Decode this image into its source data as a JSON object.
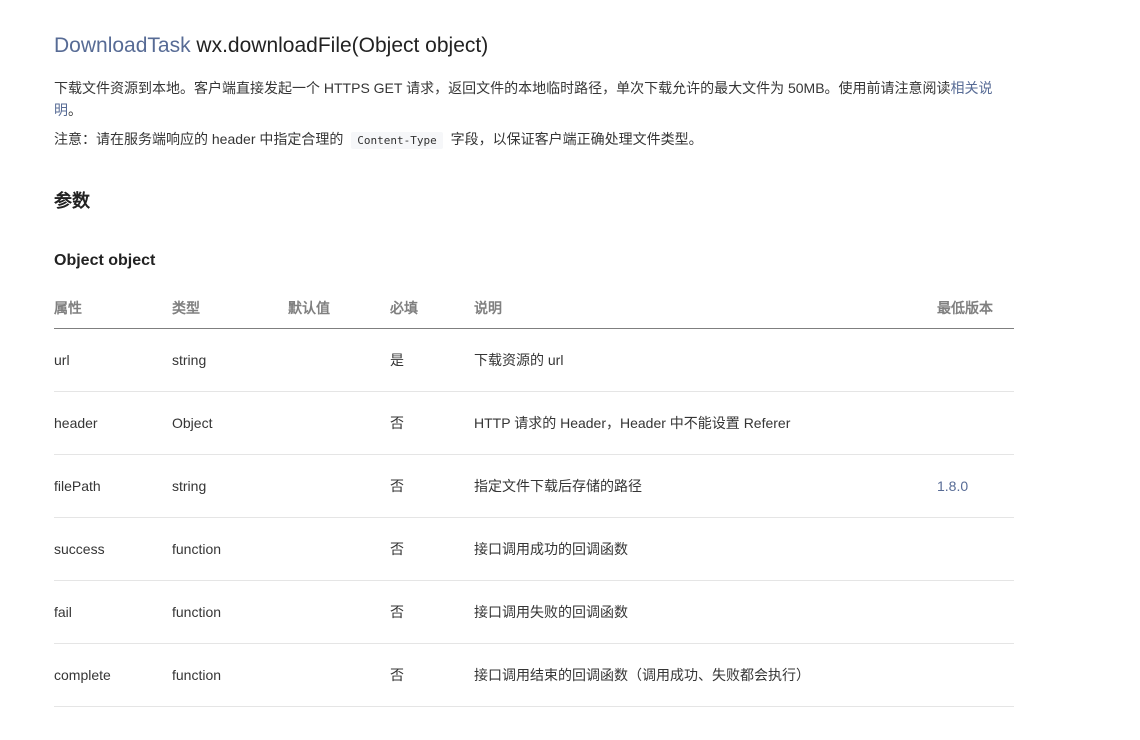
{
  "title": {
    "link_text": "DownloadTask",
    "signature": "wx.downloadFile(Object object)"
  },
  "description": {
    "text": "下载文件资源到本地。客户端直接发起一个 HTTPS GET 请求，返回文件的本地临时路径，单次下载允许的最大文件为 50MB。使用前请注意阅读",
    "link_text": "相关说明",
    "end": "。"
  },
  "note": {
    "before": "注意：请在服务端响应的 header 中指定合理的",
    "code": "Content-Type",
    "after": "字段，以保证客户端正确处理文件类型。"
  },
  "section_heading": "参数",
  "subsection_heading": "Object object",
  "table": {
    "headers": [
      "属性",
      "类型",
      "默认值",
      "必填",
      "说明",
      "最低版本"
    ],
    "rows": [
      [
        "url",
        "string",
        "",
        "是",
        "下载资源的 url",
        ""
      ],
      [
        "header",
        "Object",
        "",
        "否",
        "HTTP 请求的 Header，Header 中不能设置 Referer",
        ""
      ],
      [
        "filePath",
        "string",
        "",
        "否",
        "指定文件下载后存储的路径",
        "1.8.0"
      ],
      [
        "success",
        "function",
        "",
        "否",
        "接口调用成功的回调函数",
        ""
      ],
      [
        "fail",
        "function",
        "",
        "否",
        "接口调用失败的回调函数",
        ""
      ],
      [
        "complete",
        "function",
        "",
        "否",
        "接口调用结束的回调函数（调用成功、失败都会执行）",
        ""
      ]
    ]
  },
  "colors": {
    "link": "#576b95",
    "text": "#353535",
    "header_text": "#808080"
  }
}
